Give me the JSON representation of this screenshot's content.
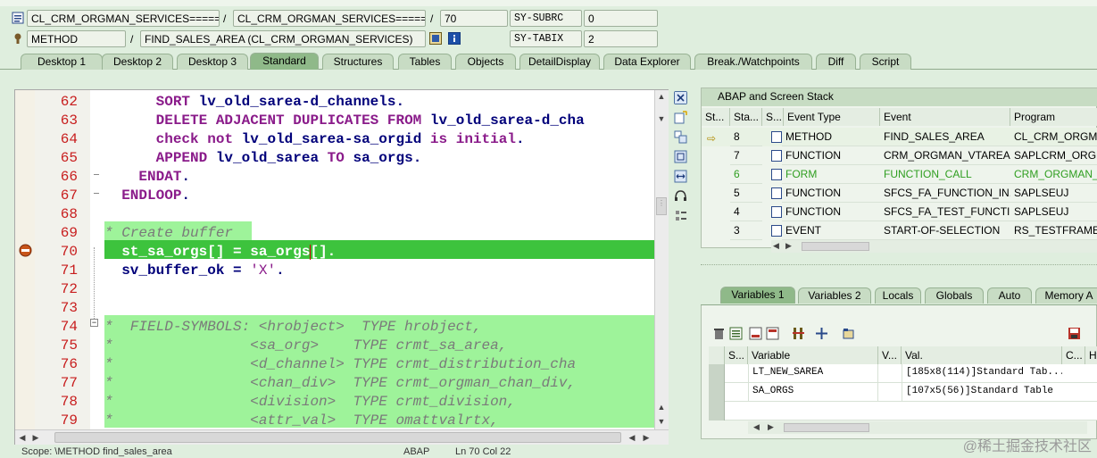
{
  "header": {
    "row1": {
      "class_name": "CL_CRM_ORGMAN_SERVICES=======...",
      "include": "CL_CRM_ORGMAN_SERVICES=======...",
      "line": "70",
      "sysfield": "SY-SUBRC",
      "sysvalue": "0"
    },
    "row2": {
      "type": "METHOD",
      "event": "FIND_SALES_AREA (CL_CRM_ORGMAN_SERVICES)",
      "sysfield": "SY-TABIX",
      "sysvalue": "2"
    }
  },
  "tabs": [
    "Desktop 1",
    "Desktop 2",
    "Desktop 3",
    "Standard",
    "Structures",
    "Tables",
    "Objects",
    "DetailDisplay",
    "Data Explorer",
    "Break./Watchpoints",
    "Diff",
    "Script"
  ],
  "code": {
    "lines": [
      {
        "n": "62",
        "text": "      SORT lv_old_sarea-d_channels."
      },
      {
        "n": "63",
        "text": "      DELETE ADJACENT DUPLICATES FROM lv_old_sarea-d_cha"
      },
      {
        "n": "64",
        "text": "      check not lv_old_sarea-sa_orgid is initial."
      },
      {
        "n": "65",
        "text": "      APPEND lv_old_sarea TO sa_orgs."
      },
      {
        "n": "66",
        "text": "    ENDAT."
      },
      {
        "n": "67",
        "text": "  ENDLOOP."
      },
      {
        "n": "68",
        "text": ""
      },
      {
        "n": "69",
        "text": "* Create buffer"
      },
      {
        "n": "70",
        "text": "  st_sa_orgs[] = sa_orgs[]."
      },
      {
        "n": "71",
        "text": "  sv_buffer_ok = 'X'."
      },
      {
        "n": "72",
        "text": ""
      },
      {
        "n": "73",
        "text": ""
      },
      {
        "n": "74",
        "text": "*  FIELD-SYMBOLS: <hrobject>  TYPE hrobject,"
      },
      {
        "n": "75",
        "text": "*                <sa_org>    TYPE crmt_sa_area,"
      },
      {
        "n": "76",
        "text": "*                <d_channel> TYPE crmt_distribution_cha"
      },
      {
        "n": "77",
        "text": "*                <chan_div>  TYPE crmt_orgman_chan_div,"
      },
      {
        "n": "78",
        "text": "*                <division>  TYPE crmt_division,"
      },
      {
        "n": "79",
        "text": "*                <attr_val>  TYPE omattvalrtx,"
      }
    ]
  },
  "status": {
    "scope": "Scope: \\METHOD find_sales_area",
    "lang": "ABAP",
    "pos": "Ln  70 Col  22"
  },
  "stack": {
    "title": "ABAP and Screen Stack",
    "columns": [
      "St...",
      "Sta...",
      "S...",
      "Event Type",
      "Event",
      "Program"
    ],
    "rows": [
      {
        "level": "8",
        "type": "METHOD",
        "event": "FIND_SALES_AREA",
        "program": "CL_CRM_ORGMAN"
      },
      {
        "level": "7",
        "type": "FUNCTION",
        "event": "CRM_ORGMAN_VTAREA...",
        "program": "SAPLCRM_ORGMA"
      },
      {
        "level": "6",
        "type": "FORM",
        "event": "FUNCTION_CALL",
        "program": "CRM_ORGMAN_V"
      },
      {
        "level": "5",
        "type": "FUNCTION",
        "event": "SFCS_FA_FUNCTION_IN...",
        "program": "SAPLSEUJ"
      },
      {
        "level": "4",
        "type": "FUNCTION",
        "event": "SFCS_FA_TEST_FUNCTI...",
        "program": "SAPLSEUJ"
      },
      {
        "level": "3",
        "type": "EVENT",
        "event": "START-OF-SELECTION",
        "program": "RS_TESTFRAME_"
      }
    ]
  },
  "var_tabs": [
    "Variables 1",
    "Variables 2",
    "Locals",
    "Globals",
    "Auto",
    "Memory A"
  ],
  "vars": {
    "columns": [
      "S...",
      "Variable",
      "V...",
      "Val.",
      "C...",
      "He"
    ],
    "rows": [
      {
        "name": "LT_NEW_SAREA",
        "value": "[185x8(114)]Standard Tab..."
      },
      {
        "name": "SA_ORGS",
        "value": "[107x5(56)]Standard Table"
      }
    ]
  },
  "watermark": "@稀土掘金技术社区",
  "colors": {
    "tab_bg": "#c8dcc4",
    "active_tab": "#8fb989",
    "highlight_comment": "#9ef39a",
    "current_line": "#3dc33d"
  }
}
